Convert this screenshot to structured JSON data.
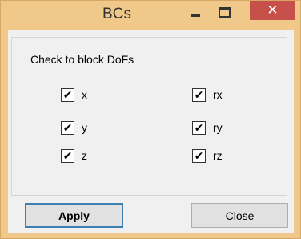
{
  "window": {
    "title": "BCs",
    "minimize_icon": "minimize-icon",
    "maximize_icon": "maximize-icon",
    "close_icon": "close-icon",
    "close_glyph": "✕"
  },
  "group": {
    "title": "Check to block DoFs",
    "items": [
      {
        "label": "x",
        "checked": true
      },
      {
        "label": "rx",
        "checked": true
      },
      {
        "label": "y",
        "checked": true
      },
      {
        "label": "ry",
        "checked": true
      },
      {
        "label": "z",
        "checked": true
      },
      {
        "label": "rz",
        "checked": true
      }
    ],
    "check_glyph": "✔"
  },
  "buttons": {
    "apply_label": "Apply",
    "close_label": "Close"
  },
  "colors": {
    "title_bar": "#f0c98a",
    "close_button": "#c7504a",
    "client_bg": "#f0f0f0",
    "default_button_border": "#3c7fb1"
  }
}
